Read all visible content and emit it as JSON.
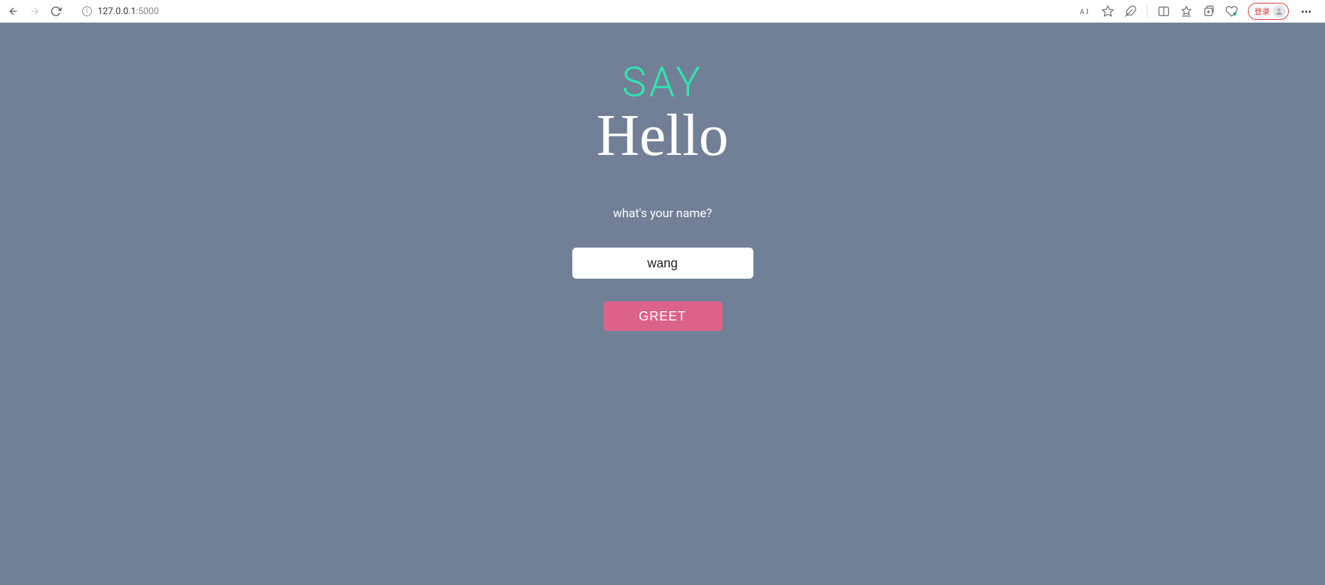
{
  "browser": {
    "url_host": "127.0.0.1",
    "url_port": ":5000",
    "login_label": "登录"
  },
  "page": {
    "heading_top": "SAY",
    "heading_bottom": "Hello",
    "prompt": "what's your name?",
    "name_value": "wang",
    "greet_label": "GREET"
  },
  "colors": {
    "page_bg": "#718096",
    "accent_teal": "#2ee6b0",
    "button_pink": "#db6289"
  }
}
